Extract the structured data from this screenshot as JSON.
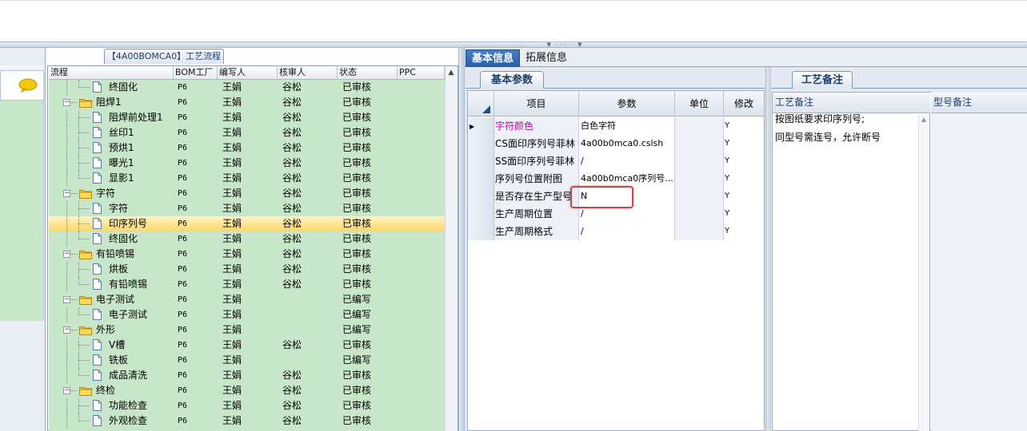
{
  "flow_tab_title": "【4A00BOMCA0】工艺流程",
  "tree": {
    "columns": [
      "流程",
      "BOM工厂",
      "编写人",
      "核审人",
      "状态",
      "PPC"
    ],
    "rows": [
      {
        "level": 2,
        "type": "doc",
        "name": "终固化",
        "bom": "P6",
        "writer": "王娟",
        "checker": "谷松",
        "status": "已审核"
      },
      {
        "level": 1,
        "type": "folder",
        "name": "阻焊1",
        "bom": "P6",
        "writer": "王娟",
        "checker": "谷松",
        "status": "已审核"
      },
      {
        "level": 2,
        "type": "doc",
        "name": "阻焊前处理1",
        "bom": "P6",
        "writer": "王娟",
        "checker": "谷松",
        "status": "已审核"
      },
      {
        "level": 2,
        "type": "doc",
        "name": "丝印1",
        "bom": "P6",
        "writer": "王娟",
        "checker": "谷松",
        "status": "已审核"
      },
      {
        "level": 2,
        "type": "doc",
        "name": "预烘1",
        "bom": "P6",
        "writer": "王娟",
        "checker": "谷松",
        "status": "已审核"
      },
      {
        "level": 2,
        "type": "doc",
        "name": "曝光1",
        "bom": "P6",
        "writer": "王娟",
        "checker": "谷松",
        "status": "已审核"
      },
      {
        "level": 2,
        "type": "doc",
        "name": "显影1",
        "bom": "P6",
        "writer": "王娟",
        "checker": "谷松",
        "status": "已审核"
      },
      {
        "level": 1,
        "type": "folder",
        "name": "字符",
        "bom": "P6",
        "writer": "王娟",
        "checker": "谷松",
        "status": "已审核"
      },
      {
        "level": 2,
        "type": "doc",
        "name": "字符",
        "bom": "P6",
        "writer": "王娟",
        "checker": "谷松",
        "status": "已审核"
      },
      {
        "level": 2,
        "type": "doc",
        "name": "印序列号",
        "bom": "P6",
        "writer": "王娟",
        "checker": "谷松",
        "status": "已审核",
        "selected": true
      },
      {
        "level": 2,
        "type": "doc",
        "name": "终固化",
        "bom": "P6",
        "writer": "王娟",
        "checker": "谷松",
        "status": "已审核"
      },
      {
        "level": 1,
        "type": "folder",
        "name": "有铅喷锡",
        "bom": "P6",
        "writer": "王娟",
        "checker": "谷松",
        "status": "已审核"
      },
      {
        "level": 2,
        "type": "doc",
        "name": "烘板",
        "bom": "P6",
        "writer": "王娟",
        "checker": "谷松",
        "status": "已审核"
      },
      {
        "level": 2,
        "type": "doc",
        "name": "有铅喷锡",
        "bom": "P6",
        "writer": "王娟",
        "checker": "谷松",
        "status": "已审核"
      },
      {
        "level": 1,
        "type": "folder",
        "name": "电子测试",
        "bom": "P6",
        "writer": "王娟",
        "checker": "",
        "status": "已编写"
      },
      {
        "level": 2,
        "type": "doc",
        "name": "电子测试",
        "bom": "P6",
        "writer": "王娟",
        "checker": "",
        "status": "已编写"
      },
      {
        "level": 1,
        "type": "folder",
        "name": "外形",
        "bom": "P6",
        "writer": "王娟",
        "checker": "",
        "status": "已编写"
      },
      {
        "level": 2,
        "type": "doc",
        "name": "V槽",
        "bom": "P6",
        "writer": "王娟",
        "checker": "谷松",
        "status": "已审核"
      },
      {
        "level": 2,
        "type": "doc",
        "name": "铣板",
        "bom": "P6",
        "writer": "王娟",
        "checker": "",
        "status": "已编写"
      },
      {
        "level": 2,
        "type": "doc",
        "name": "成品清洗",
        "bom": "P6",
        "writer": "王娟",
        "checker": "谷松",
        "status": "已审核"
      },
      {
        "level": 1,
        "type": "folder",
        "name": "终检",
        "bom": "P6",
        "writer": "王娟",
        "checker": "谷松",
        "status": "已审核"
      },
      {
        "level": 2,
        "type": "doc",
        "name": "功能检查",
        "bom": "P6",
        "writer": "王娟",
        "checker": "谷松",
        "status": "已审核"
      },
      {
        "level": 2,
        "type": "doc",
        "name": "外观检查",
        "bom": "P6",
        "writer": "王娟",
        "checker": "谷松",
        "status": "已审核"
      }
    ]
  },
  "main_tabs": [
    "基本信息",
    "拓展信息"
  ],
  "basic_params": {
    "subtab": "基本参数",
    "columns": [
      "项目",
      "参数",
      "单位",
      "修改"
    ],
    "rows": [
      {
        "item": "字符颜色",
        "param": "白色字符",
        "unit": "",
        "mod": "Y",
        "item_color": "#c000c0",
        "current": true
      },
      {
        "item": "CS面印序列号菲林",
        "param": "4a00b0mca0.cslsh",
        "unit": "",
        "mod": "Y"
      },
      {
        "item": "SS面印序列号菲林",
        "param": "/",
        "unit": "",
        "mod": "Y"
      },
      {
        "item": "序列号位置附图",
        "param": "4a00b0mca0序列号...",
        "unit": "",
        "mod": "Y"
      },
      {
        "item": "是否存在生产型号",
        "param": "N",
        "unit": "",
        "mod": "Y"
      },
      {
        "item": "生产周期位置",
        "param": "/",
        "unit": "",
        "mod": "Y"
      },
      {
        "item": "生产周期格式",
        "param": "/",
        "unit": "",
        "mod": "Y"
      }
    ]
  },
  "notes": {
    "subtab": "工艺备注",
    "col1": "工艺备注",
    "col2": "型号备注",
    "lines": [
      "按图纸要求印序列号;",
      "同型号需连号，允许断号"
    ]
  },
  "colors": {
    "tree_bg": "#c8e6c9",
    "selected_row": "#ffd66a",
    "active_tab": "#245da8",
    "highlight_box": "#c74848"
  }
}
